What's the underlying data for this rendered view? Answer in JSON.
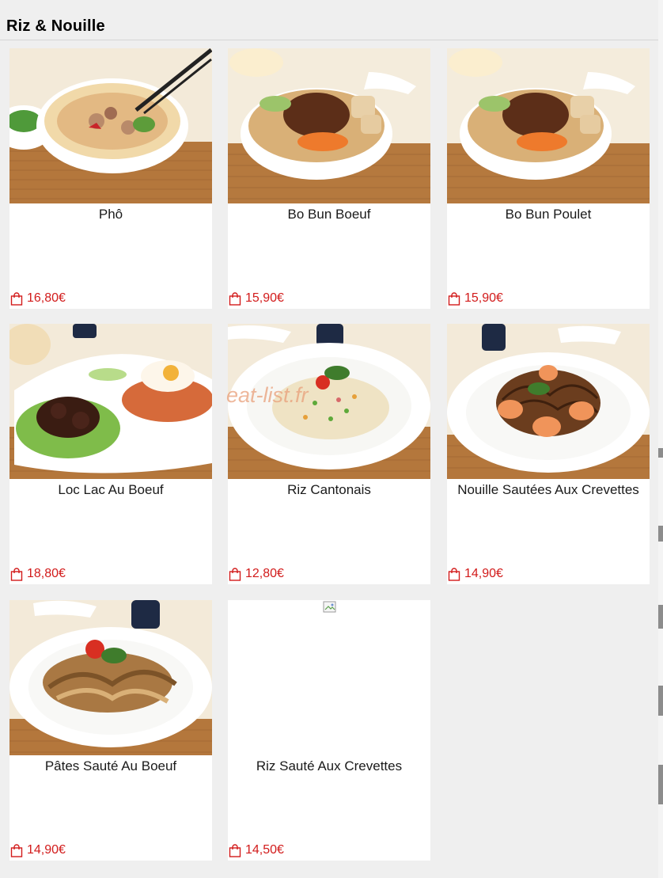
{
  "section": {
    "title": "Riz & Nouille"
  },
  "watermark": "eat-list.fr",
  "products": [
    {
      "name": "Phô",
      "price": "16,80€",
      "image": "pho-bowl"
    },
    {
      "name": "Bo Bun Boeuf",
      "price": "15,90€",
      "image": "bo-bun-bowl"
    },
    {
      "name": "Bo Bun Poulet",
      "price": "15,90€",
      "image": "bo-bun-bowl"
    },
    {
      "name": "Loc Lac Au Boeuf",
      "price": "18,80€",
      "image": "loc-lac-plate"
    },
    {
      "name": "Riz Cantonais",
      "price": "12,80€",
      "image": "fried-rice-plate"
    },
    {
      "name": "Nouille Sautées Aux Crevettes",
      "price": "14,90€",
      "image": "shrimp-noodles-plate"
    },
    {
      "name": "Pâtes Sauté Au Boeuf",
      "price": "14,90€",
      "image": "beef-noodles-plate"
    },
    {
      "name": "Riz Sauté Aux Crevettes",
      "price": "14,50€",
      "image": "broken-image"
    }
  ],
  "colors": {
    "price": "#d21b1b",
    "background": "#efefef",
    "card": "#ffffff"
  },
  "icons": {
    "price": "shopping-bag-icon",
    "missing_image": "broken-image-icon"
  }
}
